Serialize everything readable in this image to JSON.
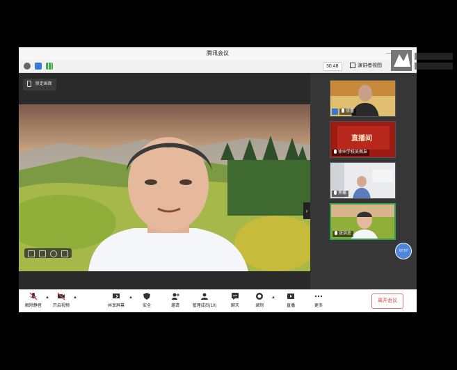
{
  "window": {
    "title": "腾讯会议",
    "minimize_glyph": "—"
  },
  "infobar": {
    "timer": "30:48",
    "speaker_view_label": "演讲者视图"
  },
  "stage": {
    "lock_label": "锁定画面",
    "collapse_glyph": "›"
  },
  "participants": [
    {
      "name": "张蕾",
      "role_icon": "host-badge-icon"
    },
    {
      "name": "徐州学校吴佩枭",
      "banner": "直播间"
    },
    {
      "name": "黑螺"
    },
    {
      "name": "张洪忠",
      "active": true
    }
  ],
  "bubble": {
    "text": "07:57"
  },
  "toolbar": {
    "mute": "解除静音",
    "video": "开启视频",
    "share": "共享屏幕",
    "security": "安全",
    "invite": "邀请",
    "members": "管理成员(10)",
    "chat": "聊天",
    "record": "录制",
    "live": "直播",
    "more": "更多",
    "leave": "离开会议"
  },
  "colors": {
    "accent_red": "#d8463c",
    "active_border": "#2fa04b",
    "bubble": "#4f86d9"
  }
}
